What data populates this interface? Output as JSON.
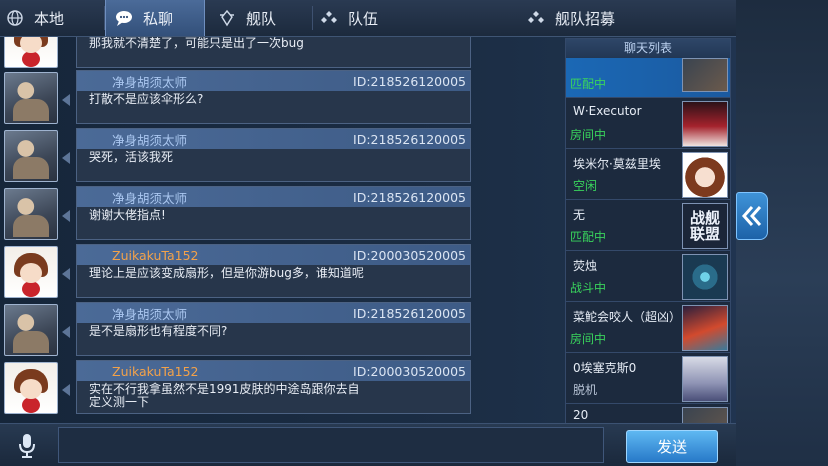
{
  "tabs": [
    {
      "label": "本地",
      "icon": "globe-icon"
    },
    {
      "label": "私聊",
      "icon": "chat-bubble-icon",
      "active": true
    },
    {
      "label": "舰队",
      "icon": "fleet-icon"
    },
    {
      "label": "队伍",
      "icon": "team-icon"
    },
    {
      "label": "舰队招募",
      "icon": "recruit-icon"
    }
  ],
  "messages": [
    {
      "name": "",
      "id": "",
      "text": "那我就不清楚了，可能只是出了一次bug",
      "avatar": "girl",
      "partial": true
    },
    {
      "name": "净身胡须太师",
      "id": "ID:218526120005",
      "text": "打散不是应该伞形么?",
      "avatar": "man",
      "gold": false
    },
    {
      "name": "净身胡须太师",
      "id": "ID:218526120005",
      "text": "哭死，活该我死",
      "avatar": "man",
      "gold": false
    },
    {
      "name": "净身胡须太师",
      "id": "ID:218526120005",
      "text": "谢谢大佬指点!",
      "avatar": "man",
      "gold": false
    },
    {
      "name": "ZuikakuTa152",
      "id": "ID:200030520005",
      "text": "理论上是应该变成扇形，但是你游bug多，谁知道呢",
      "avatar": "girl",
      "gold": true
    },
    {
      "name": "净身胡须太师",
      "id": "ID:218526120005",
      "text": "是不是扇形也有程度不同?",
      "avatar": "man",
      "gold": false
    },
    {
      "name": "ZuikakuTa152",
      "id": "ID:200030520005",
      "text": "实在不行我拿虽然不是1991皮肤的中途岛跟你去自定义测一下",
      "avatar": "girl",
      "gold": true
    }
  ],
  "sidebar": {
    "title": "聊天列表",
    "items": [
      {
        "name": "",
        "status": "匹配中",
        "avatar": "a1",
        "selected": true,
        "partial": true
      },
      {
        "name": "W·Executor",
        "status": "房间中",
        "avatar": "a2"
      },
      {
        "name": "埃米尔·莫兹里埃",
        "status": "空闲",
        "avatar": "a3"
      },
      {
        "name": "无",
        "status": "匹配中",
        "avatar": "a4",
        "logo": "战舰联盟"
      },
      {
        "name": "荧烛",
        "status": "战斗中",
        "avatar": "a5"
      },
      {
        "name": "菜鮀会咬人（超凶）",
        "status": "房间中",
        "avatar": "a6"
      },
      {
        "name": "0埃塞克斯0",
        "status": "脱机",
        "avatar": "a7"
      },
      {
        "name": "20",
        "status": "",
        "avatar": "a1",
        "partial": true
      }
    ]
  },
  "input": {
    "placeholder": "",
    "value": ""
  },
  "send_label": "发送",
  "colors": {
    "accent": "#2779c8",
    "online_status": "#39d45c",
    "gold_name": "#f3a24a",
    "name": "#aac7f0"
  }
}
